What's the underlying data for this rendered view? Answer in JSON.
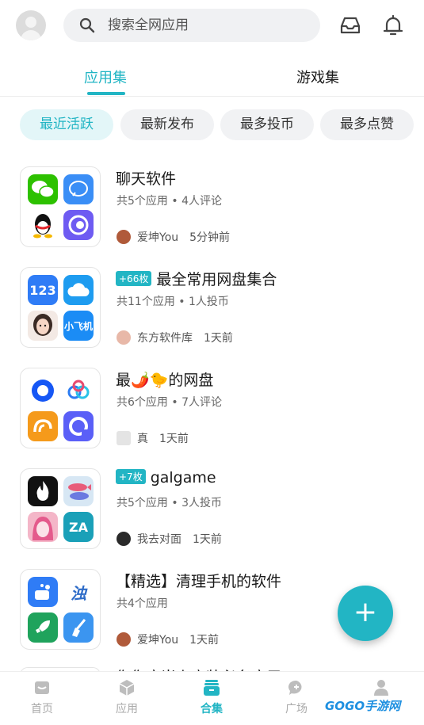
{
  "search": {
    "placeholder": "搜索全网应用"
  },
  "tabs": [
    {
      "label": "应用集",
      "active": true
    },
    {
      "label": "游戏集",
      "active": false
    }
  ],
  "filters": [
    {
      "label": "最近活跃",
      "active": true
    },
    {
      "label": "最新发布",
      "active": false
    },
    {
      "label": "最多投币",
      "active": false
    },
    {
      "label": "最多点赞",
      "active": false
    }
  ],
  "items": [
    {
      "badge": "",
      "title": "聊天软件",
      "meta": "共5个应用 • 4人评论",
      "author": "爱坤You",
      "time": "5分钟前",
      "apps": [
        "wechat-icon",
        "message-icon",
        "qq-icon",
        "browser-icon"
      ]
    },
    {
      "badge": "+66枚",
      "title": "最全常用网盘集合",
      "meta": "共11个应用 • 1人投币",
      "author": "东方软件库",
      "time": "1天前",
      "apps": [
        "123pan-icon",
        "cloud-icon",
        "avatar-girl-icon",
        "xiaofeiji-icon"
      ]
    },
    {
      "badge": "",
      "title": "最🌶️🐤的网盘",
      "meta": "共6个应用 • 7人评论",
      "author": "真",
      "time": "1天前",
      "apps": [
        "quark-icon",
        "baidu-pan-icon",
        "uc-icon",
        "aliyun-icon"
      ]
    },
    {
      "badge": "+7枚",
      "title": "galgame",
      "meta": "共5个应用 • 3人投币",
      "author": "我去对面",
      "time": "1天前",
      "apps": [
        "fire-icon",
        "fish-icon",
        "anime-girl-icon",
        "za-icon"
      ]
    },
    {
      "badge": "",
      "title": "【精选】清理手机的软件",
      "meta": "共4个应用",
      "author": "爱坤You",
      "time": "1天前",
      "apps": [
        "cleaner-icon",
        "zhuo-icon",
        "rocket-icon",
        "broom-icon"
      ]
    }
  ],
  "partial_item_title": "你你应当上商装必名应用",
  "nav": [
    {
      "label": "首页",
      "icon": "home-icon",
      "active": false
    },
    {
      "label": "应用",
      "icon": "box-icon",
      "active": false
    },
    {
      "label": "合集",
      "icon": "collection-icon",
      "active": true
    },
    {
      "label": "广场",
      "icon": "chat-bubble-icon",
      "active": false
    },
    {
      "label": "",
      "icon": "user-icon",
      "active": false
    }
  ],
  "watermark": "GOGO手游网",
  "fab_label": "+",
  "colors": {
    "accent": "#22b5c4"
  }
}
